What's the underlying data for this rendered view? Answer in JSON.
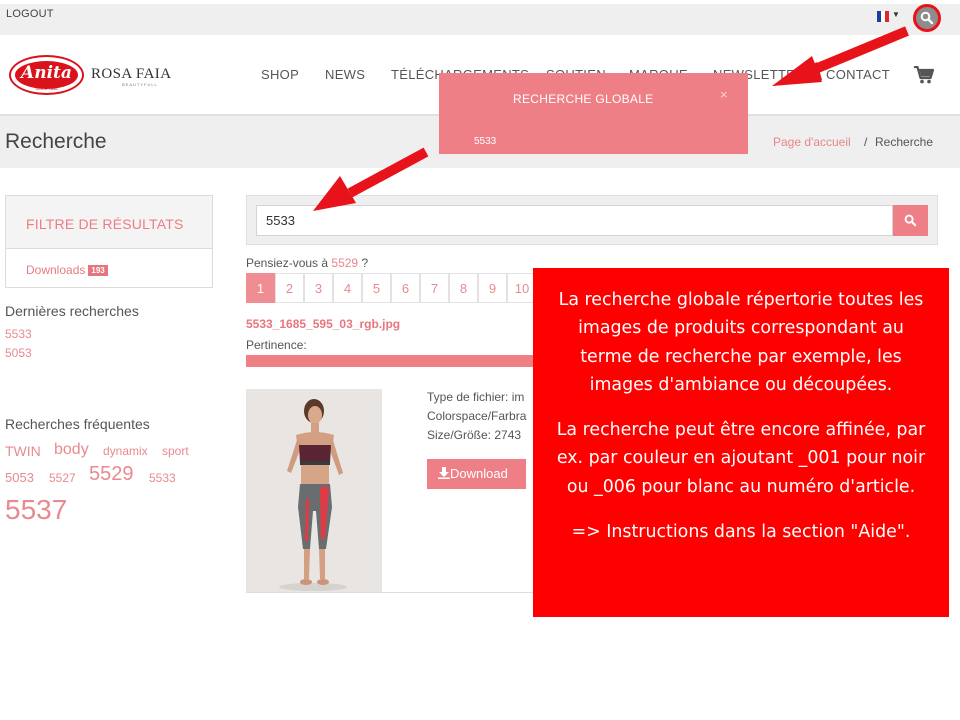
{
  "topbar": {
    "logout_label": "LOGOUT",
    "language_flag": "french-flag-icon",
    "colors": {
      "accent": "#e8131a"
    }
  },
  "header": {
    "logo_anita": "Anita",
    "logo_anita_since": "SINCE 1886",
    "logo_rosa_faia": "ROSA FAIA",
    "logo_rosa_tagline": "BEAUTYFULL",
    "nav": [
      "SHOP",
      "NEWS",
      "TÉLÉCHARGEMENTS",
      "SOUTIEN",
      "MARQUE",
      "NEWSLETTER",
      "CONTACT"
    ],
    "cart_icon": "cart-icon"
  },
  "title_band": {
    "title": "Recherche",
    "breadcrumb_home": "Page d'accueil",
    "breadcrumb_sep": "/",
    "breadcrumb_current": "Recherche"
  },
  "global_search": {
    "title": "RECHERCHE GLOBALE",
    "close": "×",
    "value": "5533"
  },
  "sidebar": {
    "filter_title": "FILTRE DE RÉSULTATS",
    "filter_item": "Downloads",
    "filter_count": "193",
    "recent_title": "Dernières recherches",
    "recent": [
      "5533",
      "5053"
    ],
    "frequent_title": "Recherches fréquentes",
    "frequent": [
      "TWIN",
      "body",
      "dynamix",
      "sport",
      "5053",
      "5527",
      "5529",
      "5533",
      "5537"
    ]
  },
  "search": {
    "value": "5533",
    "suggest_prefix": "Pensiez-vous à",
    "suggest_link": "5529",
    "suggest_suffix": "?",
    "pages": [
      "1",
      "2",
      "3",
      "4",
      "5",
      "6",
      "7",
      "8",
      "9",
      "10"
    ],
    "active_page": "1"
  },
  "result": {
    "file_name": "5533_1685_595_03_rgb.jpg",
    "relevance_label": "Pertinence:",
    "meta_type": "Type de fichier: im",
    "meta_colorspace": "Colorspace/Farbra",
    "meta_size": "Size/Größe: 2743",
    "download_label": "Download"
  },
  "callout": {
    "paragraph1": "La recherche globale répertorie toutes les images de produits correspondant au terme de recherche par exemple, les images d'ambiance ou découpées.",
    "paragraph2": "La recherche peut être encore affinée, par ex. par couleur en ajoutant _001 pour noir ou _006 pour blanc au numéro d'article.",
    "paragraph3": "=> Instructions dans la section \"Aide\"."
  }
}
